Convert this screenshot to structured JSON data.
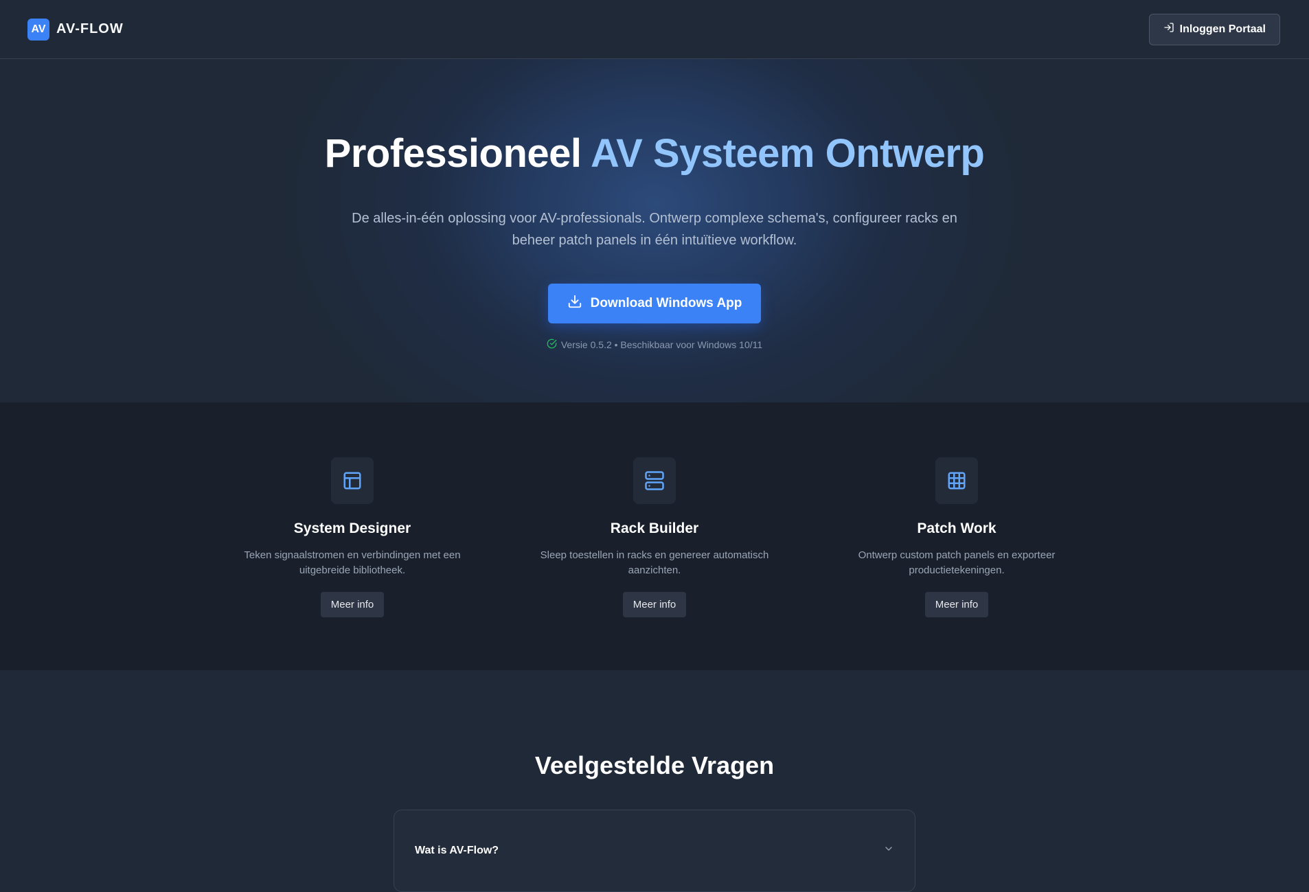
{
  "header": {
    "logo_badge": "AV",
    "brand_name": "AV-FLOW",
    "login_label": "Inloggen Portaal"
  },
  "hero": {
    "title_part1": "Professioneel",
    "title_part2": "AV Systeem Ontwerp",
    "subtitle": "De alles-in-één oplossing voor AV-professionals. Ontwerp complexe schema's, configureer racks en beheer patch panels in één intuïtieve workflow.",
    "download_label": "Download Windows App",
    "version_text": "Versie 0.5.2 • Beschikbaar voor Windows 10/11"
  },
  "features": [
    {
      "icon": "layout-icon",
      "title": "System Designer",
      "description": "Teken signaalstromen en verbindingen met een uitgebreide bibliotheek.",
      "button": "Meer info"
    },
    {
      "icon": "server-icon",
      "title": "Rack Builder",
      "description": "Sleep toestellen in racks en genereer automatisch aanzichten.",
      "button": "Meer info"
    },
    {
      "icon": "grid-icon",
      "title": "Patch Work",
      "description": "Ontwerp custom patch panels en exporteer productietekeningen.",
      "button": "Meer info"
    }
  ],
  "faq": {
    "title": "Veelgestelde Vragen",
    "items": [
      {
        "question": "Wat is AV-Flow?"
      }
    ]
  },
  "colors": {
    "accent": "#3b82f6",
    "accent_light": "#93c5fd",
    "background": "#1f2937",
    "section_dark": "#19202c",
    "success": "#22c55e"
  }
}
